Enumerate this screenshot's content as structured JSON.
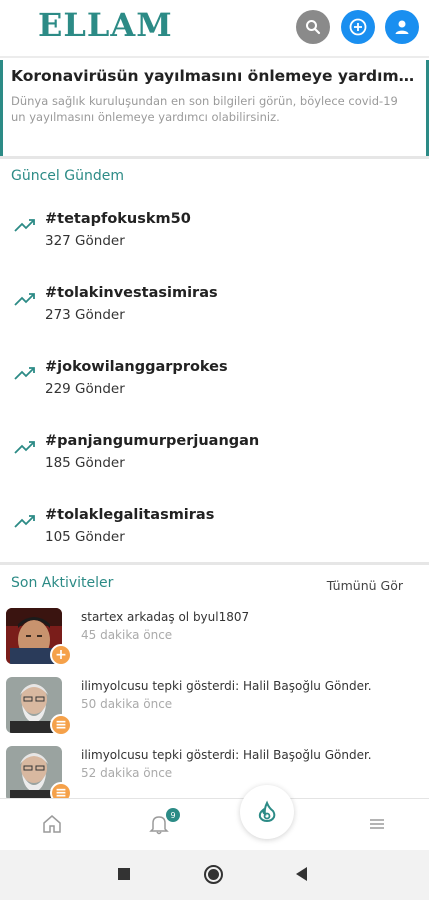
{
  "header": {
    "logo": "ELLAM",
    "search_icon": "search-icon",
    "add_icon": "plus-circle-icon",
    "profile_icon": "user-icon"
  },
  "banner": {
    "title": "Koronavirüsün yayılmasını önlemeye yardımcı ol...",
    "description": "Dünya sağlık kuruluşundan en son bilgileri görün, böylece covid-19 un yayılmasını önlemeye yardımcı olabilirsiniz."
  },
  "trending": {
    "title": "Güncel Gündem",
    "items": [
      {
        "tag": "#tetapfokuskm50",
        "count": "327 Gönder"
      },
      {
        "tag": "#tolakinvestasimiras",
        "count": "273 Gönder"
      },
      {
        "tag": "#jokowilanggarprokes",
        "count": "229 Gönder"
      },
      {
        "tag": "#panjangumurperjuangan",
        "count": "185 Gönder"
      },
      {
        "tag": "#tolaklegalitasmiras",
        "count": "105 Gönder"
      }
    ]
  },
  "activities": {
    "title": "Son Aktiviteler",
    "see_all": "Tümünü Gör",
    "items": [
      {
        "text": "startex arkadaş ol byul1807",
        "time": "45 dakika önce",
        "badge": "+"
      },
      {
        "text": "ilimyolcusu tepki gösterdi: Halil Başoğlu Gönder.",
        "time": "50 dakika önce",
        "badge": "≡"
      },
      {
        "text": "ilimyolcusu tepki gösterdi: Halil Başoğlu Gönder.",
        "time": "52 dakika önce",
        "badge": "≡"
      }
    ]
  },
  "bottom_nav": {
    "notification_count": "9",
    "items": [
      "home-icon",
      "bell-icon",
      "fire-icon",
      "menu-icon"
    ]
  },
  "colors": {
    "brand": "#2c8b86",
    "accent_blue": "#1a8ff0",
    "badge_orange": "#f5a14a"
  }
}
